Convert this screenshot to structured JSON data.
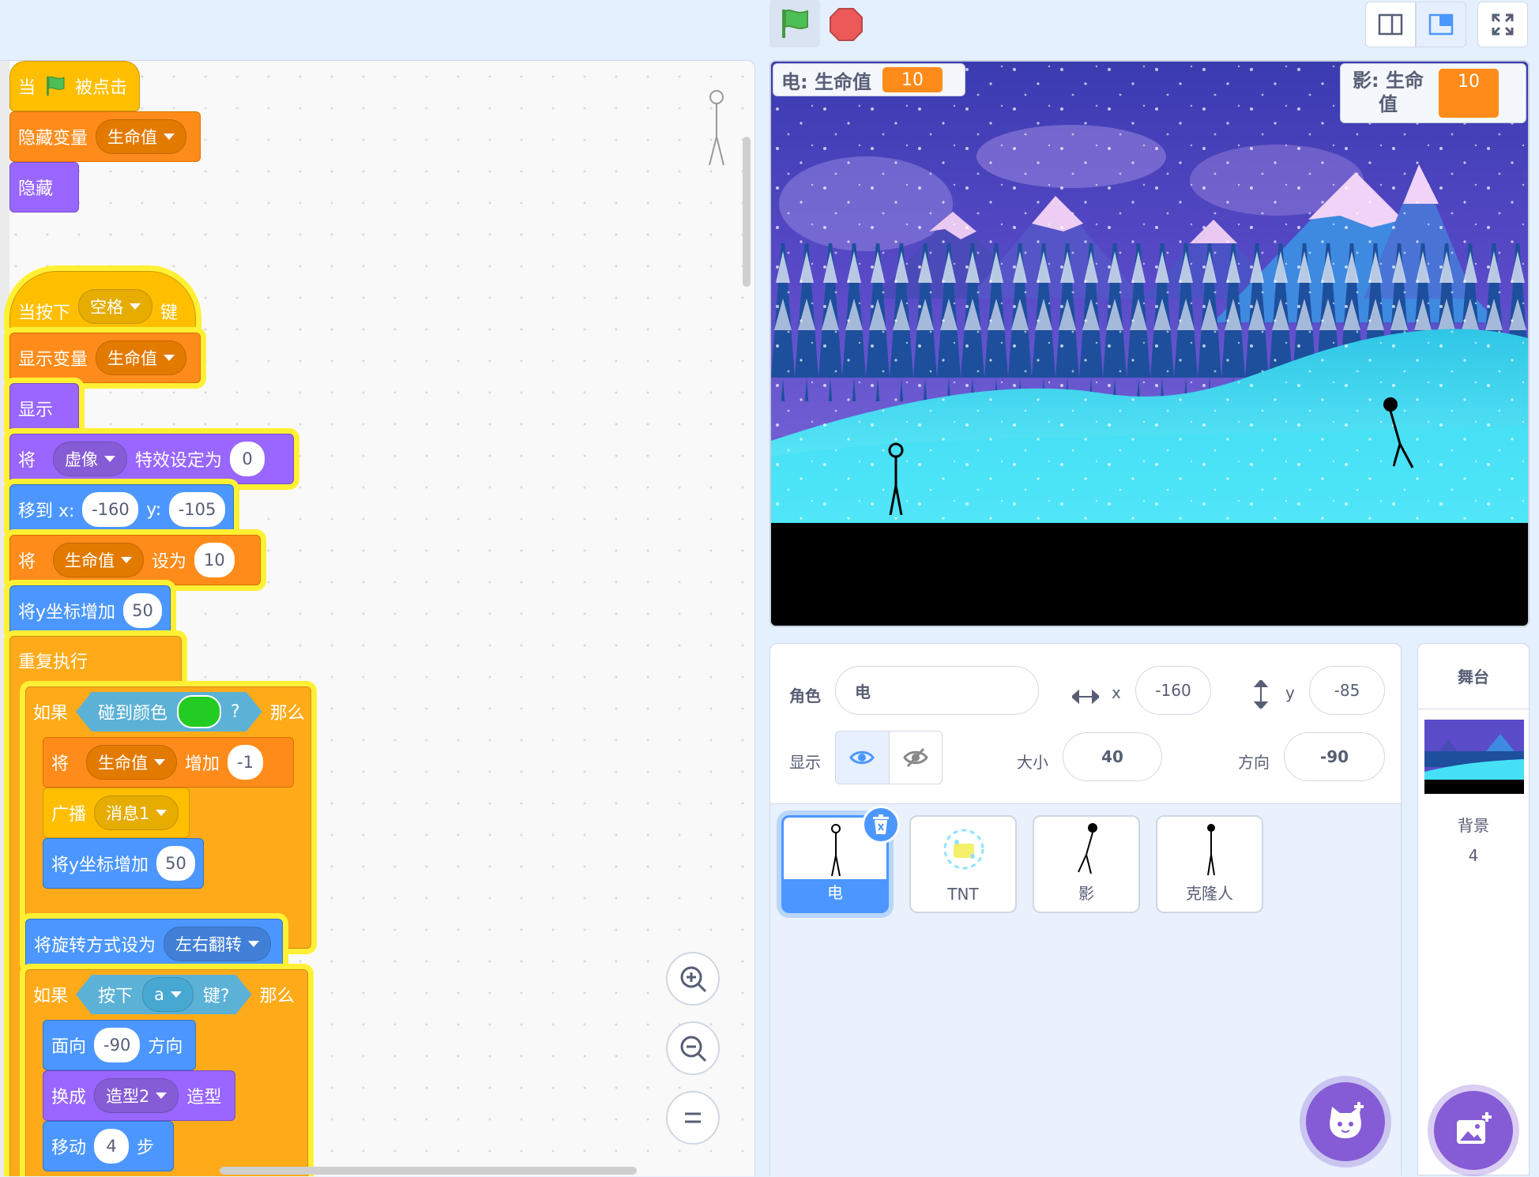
{
  "code": {
    "hat1": {
      "when": "当",
      "clicked": "被点击"
    },
    "hide_var": {
      "label": "隐藏变量",
      "var": "生命值"
    },
    "hide": {
      "label": "隐藏"
    },
    "hat2": {
      "when": "当按下",
      "key": "空格",
      "suffix": "键"
    },
    "show_var": {
      "label": "显示变量",
      "var": "生命值"
    },
    "show": {
      "label": "显示"
    },
    "set_effect": {
      "prefix": "将",
      "effect": "虚像",
      "mid": "特效设定为",
      "value": "0"
    },
    "goto": {
      "label": "移到 x:",
      "x": "-160",
      "ylabel": "y:",
      "y": "-105"
    },
    "set_var": {
      "prefix": "将",
      "var": "生命值",
      "mid": "设为",
      "value": "10"
    },
    "change_y1": {
      "label": "将y坐标增加",
      "value": "50"
    },
    "forever": {
      "label": "重复执行"
    },
    "if1": {
      "if": "如果",
      "cond": "碰到颜色",
      "q": "?",
      "then": "那么",
      "color": "#22cc22"
    },
    "change_var": {
      "prefix": "将",
      "var": "生命值",
      "mid": "增加",
      "value": "-1"
    },
    "broadcast": {
      "label": "广播",
      "msg": "消息1"
    },
    "change_y2": {
      "label": "将y坐标增加",
      "value": "50"
    },
    "rotation": {
      "label": "将旋转方式设为",
      "style": "左右翻转"
    },
    "if2": {
      "if": "如果",
      "cond": "按下",
      "key": "a",
      "suffix": "键?",
      "then": "那么"
    },
    "point": {
      "label": "面向",
      "value": "-90",
      "suffix": "方向"
    },
    "costume": {
      "label": "换成",
      "value": "造型2",
      "suffix": "造型"
    },
    "move": {
      "label": "移动",
      "value": "4",
      "suffix": "步"
    }
  },
  "stage": {
    "monitor1": {
      "label": "电: 生命值",
      "value": "10"
    },
    "monitor2": {
      "label": "影: 生命值",
      "value": "10"
    }
  },
  "sprite_info": {
    "sprite_label": "角色",
    "sprite_name": "电",
    "x_label": "x",
    "x": "-160",
    "y_label": "y",
    "y": "-85",
    "show_label": "显示",
    "size_label": "大小",
    "size": "40",
    "direction_label": "方向",
    "direction": "-90"
  },
  "sprites": [
    {
      "name": "电"
    },
    {
      "name": "TNT"
    },
    {
      "name": "影"
    },
    {
      "name": "克隆人"
    }
  ],
  "stage_panel": {
    "title": "舞台",
    "backdrop_label": "背景",
    "backdrop_count": "4"
  },
  "colors": {
    "accent": "#855cd6",
    "selected": "#4c97ff",
    "events": "#ffbf00",
    "variables": "#ff8c1a",
    "looks": "#9966ff",
    "motion": "#4c97ff",
    "control": "#ffab19",
    "sensing": "#5cb1d6"
  }
}
